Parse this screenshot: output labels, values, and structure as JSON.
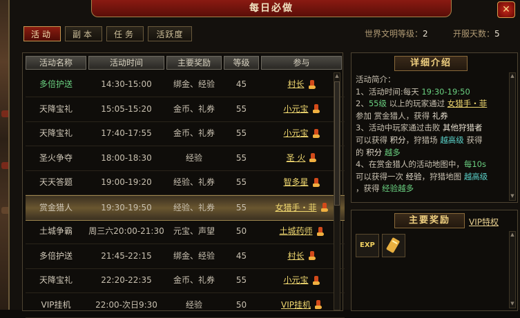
{
  "window": {
    "title": "每日必做",
    "close_glyph": "✕"
  },
  "tabs": [
    {
      "label": "活动",
      "active": true
    },
    {
      "label": "副本",
      "active": false
    },
    {
      "label": "任务",
      "active": false
    },
    {
      "label": "活跃度",
      "active": false
    }
  ],
  "status": {
    "civ_label": "世界文明等级：",
    "civ_value": "2",
    "days_label": "开服天数：",
    "days_value": "5"
  },
  "table": {
    "headers": [
      "活动名称",
      "活动时间",
      "主要奖励",
      "等级",
      "参与"
    ],
    "rows": [
      {
        "name": "多倍护送",
        "time": "14:30-15:00",
        "reward": "绑金、经验",
        "level": "45",
        "npc": "村长",
        "highlight": false,
        "name_color": "green"
      },
      {
        "name": "天降宝礼",
        "time": "15:05-15:20",
        "reward": "金币、礼券",
        "level": "55",
        "npc": "小元宝",
        "highlight": false
      },
      {
        "name": "天降宝礼",
        "time": "17:40-17:55",
        "reward": "金币、礼券",
        "level": "55",
        "npc": "小元宝",
        "highlight": false
      },
      {
        "name": "圣火争夺",
        "time": "18:00-18:30",
        "reward": "经验",
        "level": "55",
        "npc": "圣 火",
        "highlight": false
      },
      {
        "name": "天天答题",
        "time": "19:00-19:20",
        "reward": "经验、礼券",
        "level": "55",
        "npc": "智多星",
        "highlight": false
      },
      {
        "name": "赏金猎人",
        "time": "19:30-19:50",
        "reward": "经验、礼券",
        "level": "55",
        "npc": "女猎手・菲",
        "highlight": true
      },
      {
        "name": "土城争霸",
        "time": "周三六20:00-21:30",
        "reward": "元宝、声望",
        "level": "50",
        "npc": "土城药师",
        "highlight": false
      },
      {
        "name": "多倍护送",
        "time": "21:45-22:15",
        "reward": "绑金、经验",
        "level": "45",
        "npc": "村长",
        "highlight": false
      },
      {
        "name": "天降宝礼",
        "time": "22:20-22:35",
        "reward": "金币、礼券",
        "level": "55",
        "npc": "小元宝",
        "highlight": false
      },
      {
        "name": "VIP挂机",
        "time": "22:00-次日9:30",
        "reward": "经验",
        "level": "50",
        "npc": "VIP挂机",
        "highlight": false
      }
    ]
  },
  "detail": {
    "title": "详细介绍",
    "intro": "活动简介：",
    "l1a": "1、活动时间:每天 ",
    "l1b": "19:30-19:50",
    "l2a": "2、",
    "l2b": "55级",
    "l2c": " 以上的玩家通过 ",
    "l2d": "女猎手・菲",
    "l3a": "参加 赏金猎人，获得 ",
    "l3b": "礼券",
    "l4a": "3、活动中玩家通过击败 ",
    "l4b": "其他狩猎者",
    "l5a": "可以获得 ",
    "l5b": "积分",
    "l5c": "，狩猎场 ",
    "l5d": "越高级",
    "l5e": " 获得",
    "l6a": "的 ",
    "l6b": "积分",
    "l6c": " ",
    "l6d": "越多",
    "l7a": "4、在赏金猎人的活动地图中，",
    "l7b": "每10s",
    "l8a": "可以获得一次 ",
    "l8b": "经验",
    "l8c": "，狩猎地图 ",
    "l8d": "越高级",
    "l9a": "，获得 ",
    "l9b": "经验越多"
  },
  "rewards": {
    "title": "主要奖励",
    "vip_link": "VIP特权",
    "items": [
      "exp-item",
      "gold-ticket-item"
    ],
    "exp_text": "EXP"
  },
  "colors": {
    "accent_red": "#8a1a12",
    "gold": "#f0d870",
    "green": "#6ad080",
    "cyan": "#5ad0c8"
  }
}
